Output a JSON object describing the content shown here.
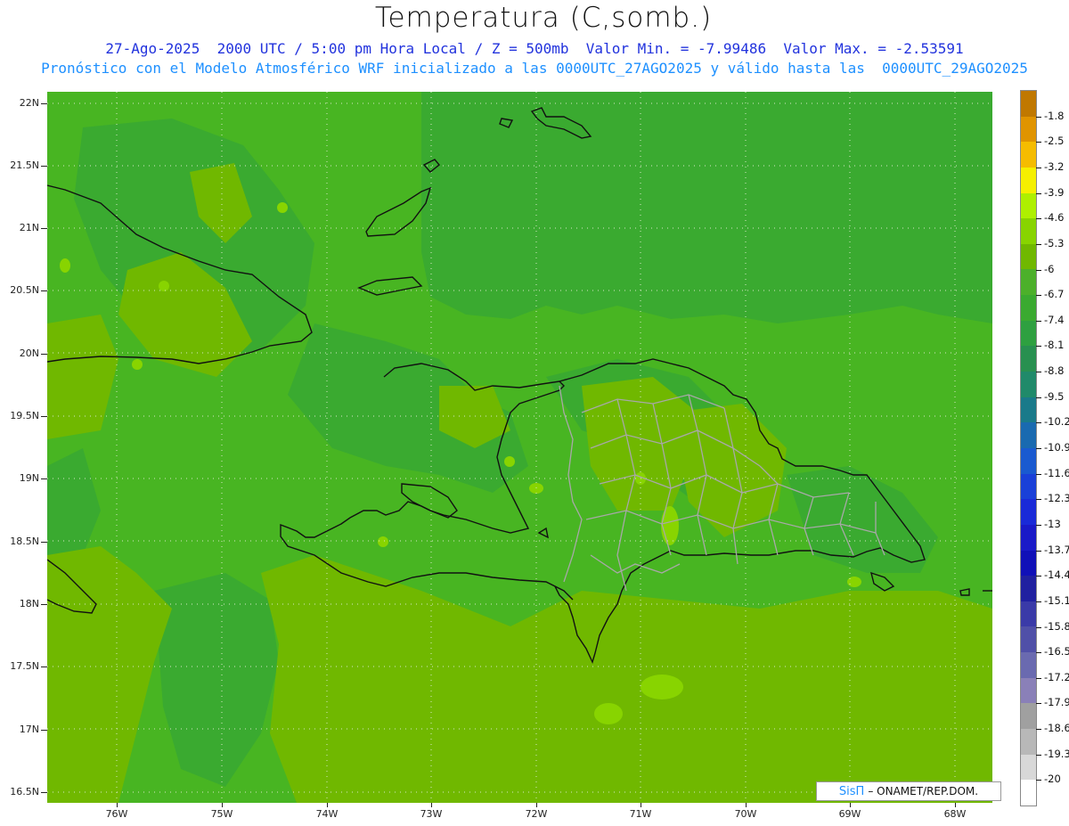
{
  "header": {
    "title": "Temperatura (C,somb.)",
    "line1": "27-Ago-2025  2000 UTC / 5:00 pm Hora Local / Z = 500mb  Valor Min. = -7.99486  Valor Max. = -2.53591",
    "line2": "Pronóstico con el Modelo Atmosférico WRF inicializado a las 0000UTC_27AGO2025 y válido hasta las  0000UTC_29AGO2025"
  },
  "map": {
    "lat_labels": [
      "22N",
      "21.5N",
      "21N",
      "20.5N",
      "20N",
      "19.5N",
      "19N",
      "18.5N",
      "18N",
      "17.5N",
      "17N",
      "16.5N"
    ],
    "lon_labels": [
      "76W",
      "75W",
      "74W",
      "73W",
      "72W",
      "71W",
      "70W",
      "69W",
      "68W"
    ],
    "lat_range": [
      16.4,
      22.1
    ],
    "lon_range": [
      -76.65,
      -67.65
    ]
  },
  "colorbar": {
    "labels": [
      "-1.8",
      "-2.5",
      "-3.2",
      "-3.9",
      "-4.6",
      "-5.3",
      "-6",
      "-6.7",
      "-7.4",
      "-8.1",
      "-8.8",
      "-9.5",
      "-10.2",
      "-10.9",
      "-11.6",
      "-12.3",
      "-13",
      "-13.7",
      "-14.4",
      "-15.1",
      "-15.8",
      "-16.5",
      "-17.2",
      "-17.9",
      "-18.6",
      "-19.3",
      "-20"
    ],
    "colors": [
      "#c07800",
      "#e09400",
      "#f5bc00",
      "#f5f000",
      "#aef000",
      "#88d400",
      "#70b800",
      "#4cb02a",
      "#3aaa30",
      "#2ea040",
      "#289050",
      "#208a6a",
      "#1a7a8a",
      "#1a6ab0",
      "#1a5ad0",
      "#1a40d8",
      "#1a2ad8",
      "#1a1ac8",
      "#1010b8",
      "#2020a0",
      "#3a3aa8",
      "#5050a8",
      "#6a6ab0",
      "#8a80b8",
      "#a0a0a0",
      "#b8b8b8",
      "#d8d8d8",
      "#ffffff"
    ]
  },
  "brand": {
    "sis": "SisΠ",
    "org": "– ONAMET/REP.DOM."
  }
}
